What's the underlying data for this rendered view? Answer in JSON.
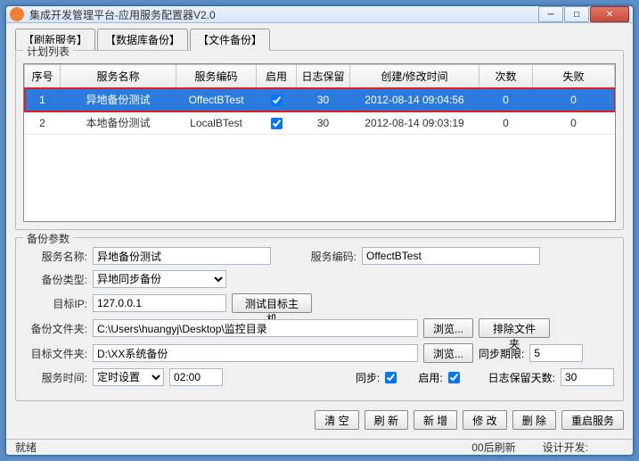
{
  "window": {
    "title": "集成开发管理平台-应用服务配置器V2.0"
  },
  "tabs": [
    {
      "label": "【刷新服务】"
    },
    {
      "label": "【数据库备份】"
    },
    {
      "label": "【文件备份】"
    }
  ],
  "planList": {
    "title": "计划列表"
  },
  "table": {
    "headers": {
      "seq": "序号",
      "name": "服务名称",
      "code": "服务编码",
      "enable": "启用",
      "log": "日志保留",
      "time": "创建/修改时间",
      "count": "次数",
      "fail": "失败"
    },
    "rows": [
      {
        "seq": "1",
        "name": "异地备份测试",
        "code": "OffectBTest",
        "enable": true,
        "log": "30",
        "time": "2012-08-14 09:04:56",
        "count": "0",
        "fail": "0"
      },
      {
        "seq": "2",
        "name": "本地备份测试",
        "code": "LocalBTest",
        "enable": true,
        "log": "30",
        "time": "2012-08-14 09:03:19",
        "count": "0",
        "fail": "0"
      }
    ]
  },
  "params": {
    "title": "备份参数",
    "nameLabel": "服务名称:",
    "name": "异地备份测试",
    "codeLabel": "服务编码:",
    "code": "OffectBTest",
    "typeLabel": "备份类型:",
    "type": "异地同步备份",
    "ipLabel": "目标IP:",
    "ip": "127.0.0.1",
    "testBtn": "测试目标主机",
    "srcLabel": "备份文件夹:",
    "src": "C:\\Users\\huangyj\\Desktop\\监控目录",
    "browse": "浏览...",
    "excludeBtn": "排除文件夹",
    "dstLabel": "目标文件夹:",
    "dst": "D:\\XX系统备份",
    "syncLimitLabel": "同步期限:",
    "syncLimit": "5",
    "timeLabel": "服务时间:",
    "timeMode": "定时设置",
    "timeVal": "02:00",
    "syncLabel": "同步:",
    "enableLabel": "启用:",
    "logDaysLabel": "日志保留天数:",
    "logDays": "30"
  },
  "buttons": {
    "clear": "清 空",
    "refresh": "刷 新",
    "add": "新 增",
    "edit": "修 改",
    "del": "删 除",
    "restart": "重启服务"
  },
  "status": {
    "ready": "就绪",
    "refresh": "00后刷新",
    "dev": "设计开发:"
  }
}
